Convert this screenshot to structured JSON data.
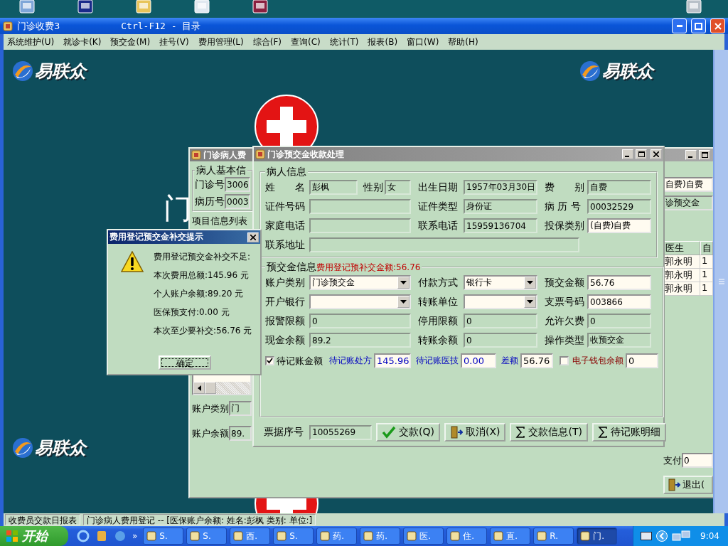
{
  "app_window": {
    "title": "门诊收费3",
    "subtitle": "Ctrl-F12 - 目录"
  },
  "menu": [
    "系统维护(U)",
    "就诊卡(K)",
    "预交金(M)",
    "挂号(V)",
    "费用管理(L)",
    "综合(F)",
    "查询(C)",
    "统计(T)",
    "报表(B)",
    "窗口(W)",
    "帮助(H)"
  ],
  "workspace": {
    "logos": [
      "易联众",
      "易联众",
      "易联众"
    ],
    "background_text": "门"
  },
  "background_window": {
    "title": "门诊病人费",
    "group_title": "病人基本信",
    "fields_left": [
      {
        "label": "门诊号",
        "value": "3006"
      },
      {
        "label": "病历号",
        "value": "0003"
      }
    ],
    "list_title": "项目信息列表",
    "bottom_left": [
      {
        "label": "账户类别",
        "value": "门"
      },
      {
        "label": "账户余额",
        "value": "89."
      }
    ],
    "fields_right": [
      {
        "value": "自费)自费",
        "kind": "input"
      },
      {
        "value": "诊预交金",
        "kind": "readonly"
      }
    ],
    "table": {
      "columns": [
        "医生",
        "自"
      ],
      "rows": [
        [
          "郭永明",
          "1"
        ],
        [
          "郭永明",
          "1"
        ],
        [
          "郭永明",
          "1"
        ]
      ]
    },
    "pay_label": "支付",
    "pay_value": "0",
    "exit_button": "退出("
  },
  "prepay_dialog": {
    "title": "门诊预交金收款处理",
    "patient_group": {
      "title": "病人信息",
      "rows": [
        [
          [
            {
              "label": "姓　　名",
              "value": "彭枫",
              "kind": "readonly"
            },
            {
              "label": "性别",
              "value": "女",
              "kind": "readonly"
            }
          ],
          [
            {
              "label": "出生日期",
              "value": "1957年03月30日",
              "kind": "readonly"
            }
          ],
          [
            {
              "label": "费　　别",
              "value": "自费",
              "kind": "readonly"
            }
          ]
        ],
        [
          [
            {
              "label": "证件号码",
              "kind": "readonly"
            }
          ],
          [
            {
              "label": "证件类型",
              "value": "身份证",
              "kind": "readonly"
            }
          ],
          [
            {
              "label": "病 历 号",
              "value": "00032529",
              "kind": "readonly"
            }
          ]
        ],
        [
          [
            {
              "label": "家庭电话",
              "kind": "readonly"
            }
          ],
          [
            {
              "label": "联系电话",
              "value": "15959136704",
              "kind": "readonly"
            }
          ],
          [
            {
              "label": "投保类别",
              "value": "(自费)自费",
              "kind": "input"
            }
          ]
        ],
        [
          [
            {
              "label": "联系地址",
              "kind": "readonly"
            }
          ]
        ]
      ]
    },
    "prepay_group": {
      "title": "预交金信息",
      "note": "费用登记预补交金额:56.76",
      "rows": [
        [
          [
            {
              "label": "账户类别",
              "value": "门诊预交金",
              "kind": "select"
            }
          ],
          [
            {
              "label": "付款方式",
              "value": "银行卡",
              "kind": "select"
            }
          ],
          [
            {
              "label": "预交金额",
              "value": "56.76",
              "kind": "input"
            }
          ]
        ],
        [
          [
            {
              "label": "开户银行",
              "kind": "select"
            }
          ],
          [
            {
              "label": "转账单位",
              "kind": "select"
            }
          ],
          [
            {
              "label": "支票号码",
              "value": "003866",
              "kind": "input"
            }
          ]
        ],
        [
          [
            {
              "label": "报警限额",
              "value": "0",
              "kind": "readonly"
            }
          ],
          [
            {
              "label": "停用限额",
              "value": "0",
              "kind": "readonly"
            }
          ],
          [
            {
              "label": "允许欠费",
              "value": "0",
              "kind": "readonly"
            }
          ]
        ],
        [
          [
            {
              "label": "现金余额",
              "value": "89.2",
              "kind": "readonly"
            }
          ],
          [
            {
              "label": "转账余额",
              "value": "0",
              "kind": "readonly"
            }
          ],
          [
            {
              "label": "操作类型",
              "value": "收预交金",
              "kind": "readonly"
            }
          ]
        ]
      ],
      "pending": {
        "checked": true,
        "label": "待记账金额",
        "items": [
          {
            "label": "待记账处方",
            "value": "145.96"
          },
          {
            "label": "待记账医技",
            "value": "0.00"
          },
          {
            "label": "差额",
            "value": "56.76"
          }
        ]
      },
      "wallet": {
        "checked": false,
        "label": "电子钱包余额",
        "value": "0"
      }
    },
    "receipt": {
      "label": "票据序号",
      "value": "10055269"
    },
    "buttons": [
      {
        "label": "交款(Q)",
        "kind": "confirm"
      },
      {
        "label": "取消(X)",
        "kind": "cancel"
      },
      {
        "label": "交款信息(T)",
        "kind": "sum"
      },
      {
        "label": "待记账明细",
        "kind": "sum"
      }
    ]
  },
  "alert": {
    "title": "费用登记预交金补交提示",
    "lines": [
      "费用登记预交金补交不足:",
      "本次费用总额:145.96 元",
      "个人账户余额:89.20 元",
      "医保预支付:0.00 元",
      "本次至少要补交:56.76 元"
    ],
    "button": "确定"
  },
  "status_bar": [
    "收费员交款日报表",
    "门诊病人费用登记 -- [医保账户余额: 姓名:彭枫 类别: 单位:]"
  ],
  "taskbar": {
    "start": "开始",
    "more": "»",
    "tasks": [
      {
        "label": "S.",
        "selected": false
      },
      {
        "label": "S.",
        "selected": false
      },
      {
        "label": "西.",
        "selected": false
      },
      {
        "label": "S.",
        "selected": false
      },
      {
        "label": "药.",
        "selected": false
      },
      {
        "label": "药.",
        "selected": false
      },
      {
        "label": "医.",
        "selected": false
      },
      {
        "label": "住.",
        "selected": false
      },
      {
        "label": "直.",
        "selected": false
      },
      {
        "label": "R.",
        "selected": false
      },
      {
        "label": "门.",
        "selected": true
      }
    ],
    "clock": "9:04"
  }
}
